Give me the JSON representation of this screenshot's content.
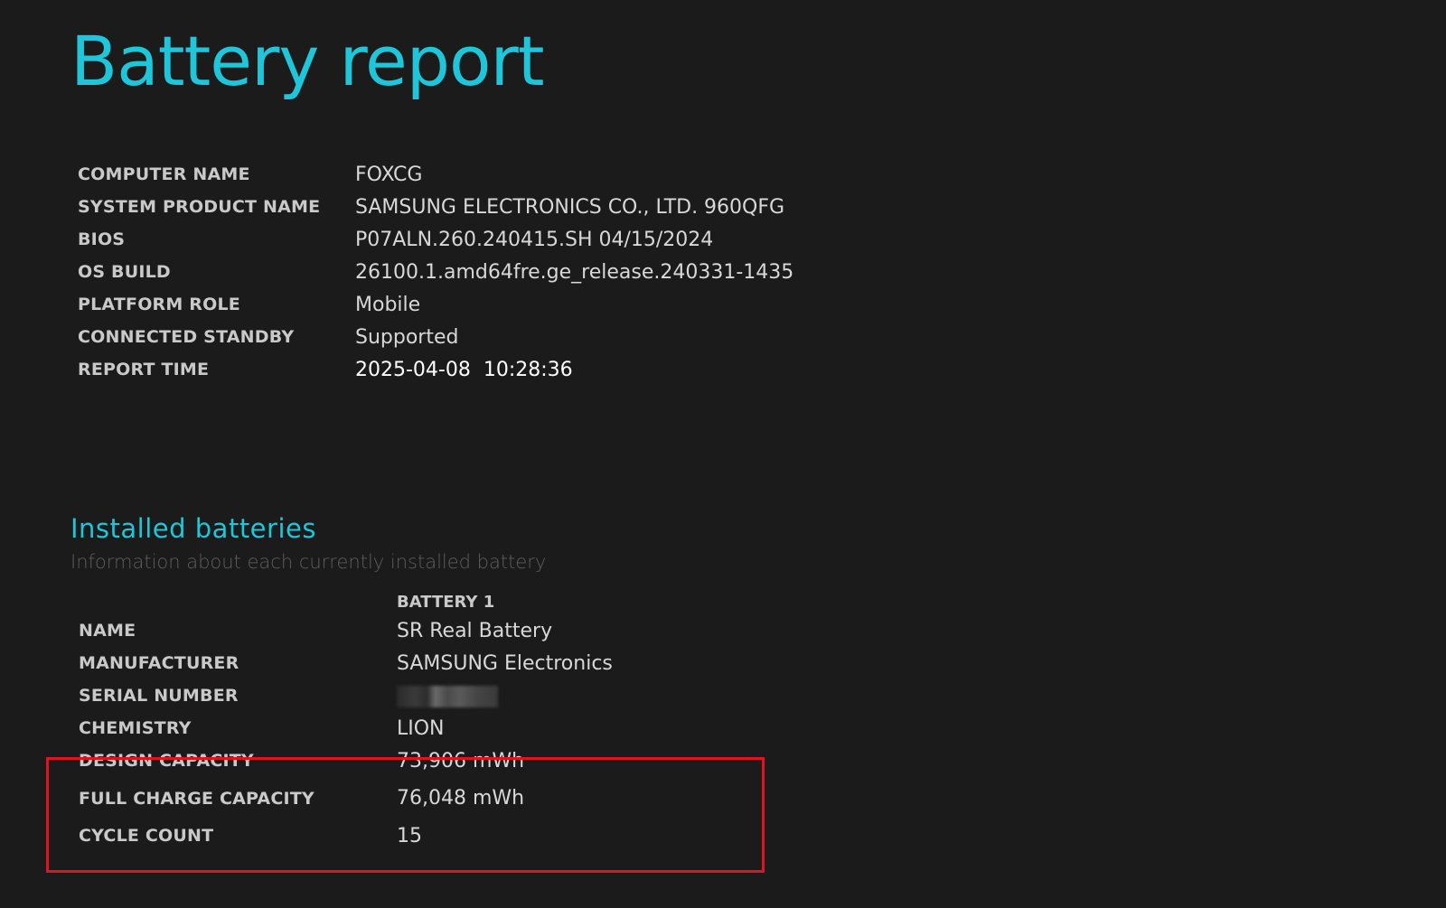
{
  "title": "Battery report",
  "system_info": [
    {
      "label": "COMPUTER NAME",
      "value": "FOXCG"
    },
    {
      "label": "SYSTEM PRODUCT NAME",
      "value": "SAMSUNG ELECTRONICS CO., LTD. 960QFG"
    },
    {
      "label": "BIOS",
      "value": "P07ALN.260.240415.SH 04/15/2024"
    },
    {
      "label": "OS BUILD",
      "value": "26100.1.amd64fre.ge_release.240331-1435"
    },
    {
      "label": "PLATFORM ROLE",
      "value": "Mobile"
    },
    {
      "label": "CONNECTED STANDBY",
      "value": "Supported"
    },
    {
      "label": "REPORT TIME",
      "value": "2025-04-08  10:28:36"
    }
  ],
  "installed_batteries": {
    "title": "Installed batteries",
    "subtitle": "Information about each currently installed battery",
    "column_header": "BATTERY 1",
    "rows": [
      {
        "label": "NAME",
        "value": "SR Real Battery"
      },
      {
        "label": "MANUFACTURER",
        "value": "SAMSUNG Electronics"
      },
      {
        "label": "SERIAL NUMBER",
        "value": ""
      },
      {
        "label": "CHEMISTRY",
        "value": "LION"
      },
      {
        "label": "DESIGN CAPACITY",
        "value": "73,906 mWh"
      },
      {
        "label": "FULL CHARGE CAPACITY",
        "value": "76,048 mWh"
      },
      {
        "label": "CYCLE COUNT",
        "value": "15"
      }
    ]
  },
  "colors": {
    "accent": "#1fc5d9",
    "background": "#1b1b1b",
    "highlight_border": "#e0141e"
  }
}
